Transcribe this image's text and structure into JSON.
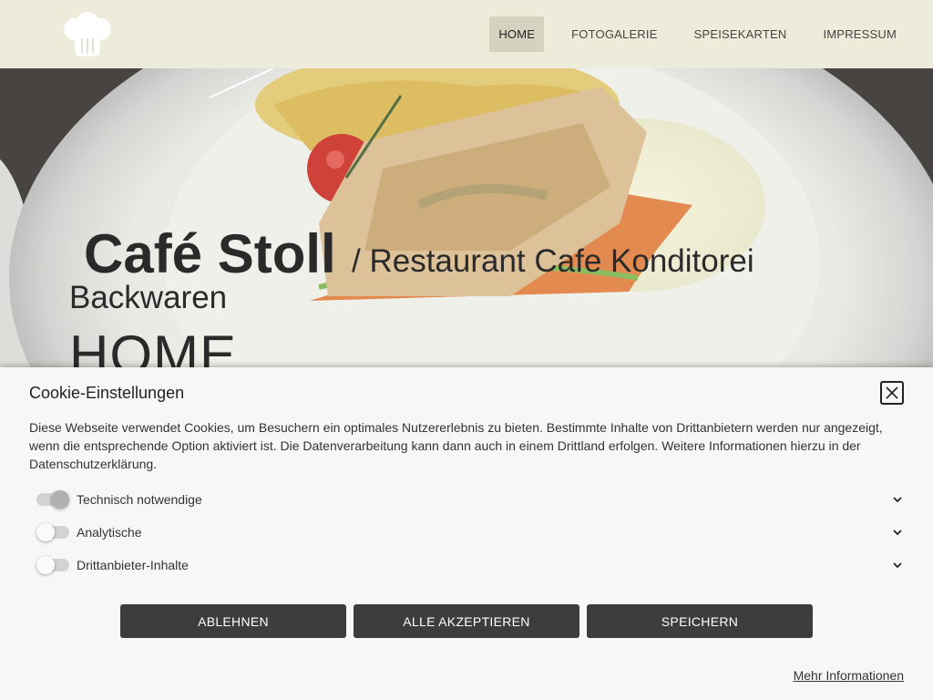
{
  "nav": {
    "items": [
      {
        "label": "HOME",
        "active": true
      },
      {
        "label": "FOTOGALERIE",
        "active": false
      },
      {
        "label": "SPEISEKARTEN",
        "active": false
      },
      {
        "label": "IMPRESSUM",
        "active": false
      }
    ]
  },
  "logo": {
    "icon": "chef-hat-icon"
  },
  "hero": {
    "title": "Café Stoll",
    "subtitle": "/ Restaurant Cafe Konditorei",
    "subtitle2": "Backwaren",
    "page_heading": "HOME"
  },
  "cookie": {
    "title": "Cookie-Einstellungen",
    "text": "Diese Webseite verwendet Cookies, um Besuchern ein optimales Nutzererlebnis zu bieten. Bestimmte Inhalte von Drittanbietern werden nur angezeigt, wenn die entsprechende Option aktiviert ist. Die Datenverarbeitung kann dann auch in einem Drittland erfolgen. Weitere Informationen hierzu in der Datenschutzerklärung.",
    "options": [
      {
        "label": "Technisch notwendige",
        "enabled": true
      },
      {
        "label": "Analytische",
        "enabled": false
      },
      {
        "label": "Drittanbieter-Inhalte",
        "enabled": false
      }
    ],
    "buttons": {
      "decline": "ABLEHNEN",
      "accept_all": "ALLE AKZEPTIEREN",
      "save": "SPEICHERN"
    },
    "more_info": "Mehr Informationen"
  },
  "colors": {
    "header_bg": "#edebd9",
    "active_nav_bg": "#d6d2c0",
    "button_bg": "#3d3d3d",
    "cookie_bg": "#f7f7f7"
  }
}
